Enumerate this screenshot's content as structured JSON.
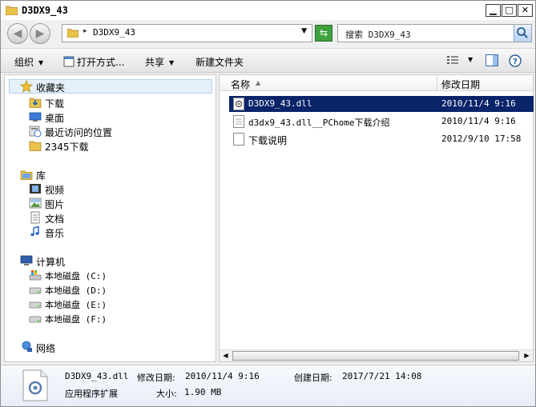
{
  "window": {
    "title": "D3DX9_43"
  },
  "address_bar": {
    "path": "D3DX9_43",
    "separator": "▸"
  },
  "search": {
    "text": "搜索 D3DX9_43"
  },
  "toolbar": {
    "organize": "组织",
    "open_with": "打开方式...",
    "share": "共享",
    "new_folder": "新建文件夹"
  },
  "nav_pane": {
    "favorites": {
      "label": "收藏夹",
      "items": [
        {
          "label": "下载",
          "icon": "download-folder-icon"
        },
        {
          "label": "桌面",
          "icon": "desktop-icon"
        },
        {
          "label": "最近访问的位置",
          "icon": "recent-places-icon"
        },
        {
          "label": "2345下载",
          "icon": "folder-icon"
        }
      ]
    },
    "libraries": {
      "label": "库",
      "items": [
        {
          "label": "视频",
          "icon": "video-icon"
        },
        {
          "label": "图片",
          "icon": "picture-icon"
        },
        {
          "label": "文档",
          "icon": "document-icon"
        },
        {
          "label": "音乐",
          "icon": "music-icon"
        }
      ]
    },
    "computer": {
      "label": "计算机",
      "items": [
        {
          "label": "本地磁盘 (C:)",
          "icon": "system-drive-icon"
        },
        {
          "label": "本地磁盘 (D:)",
          "icon": "drive-icon"
        },
        {
          "label": "本地磁盘 (E:)",
          "icon": "drive-icon"
        },
        {
          "label": "本地磁盘 (F:)",
          "icon": "drive-icon"
        }
      ]
    },
    "network": {
      "label": "网络"
    }
  },
  "file_list": {
    "columns": {
      "name": "名称",
      "date": "修改日期"
    },
    "files": [
      {
        "name": "D3DX9_43.dll",
        "date": "2010/11/4 9:16",
        "selected": true,
        "icon": "dll-file-icon"
      },
      {
        "name": "d3dx9_43.dll__PChome下载介绍",
        "date": "2010/11/4 9:16",
        "selected": false,
        "icon": "text-file-icon"
      },
      {
        "name": "下载说明",
        "date": "2012/9/10 17:58",
        "selected": false,
        "icon": "blank-file-icon"
      }
    ]
  },
  "details": {
    "filename": "D3DX9_43.dll",
    "modified_label": "修改日期:",
    "modified_value": "2010/11/4 9:16",
    "created_label": "创建日期:",
    "created_value": "2017/7/21 14:08",
    "type": "应用程序扩展",
    "size_label": "大小:",
    "size_value": "1.90 MB"
  },
  "colors": {
    "selection": "#0a246a",
    "nav_highlight": "#e6f0fb",
    "refresh_green": "#3ea13e"
  }
}
